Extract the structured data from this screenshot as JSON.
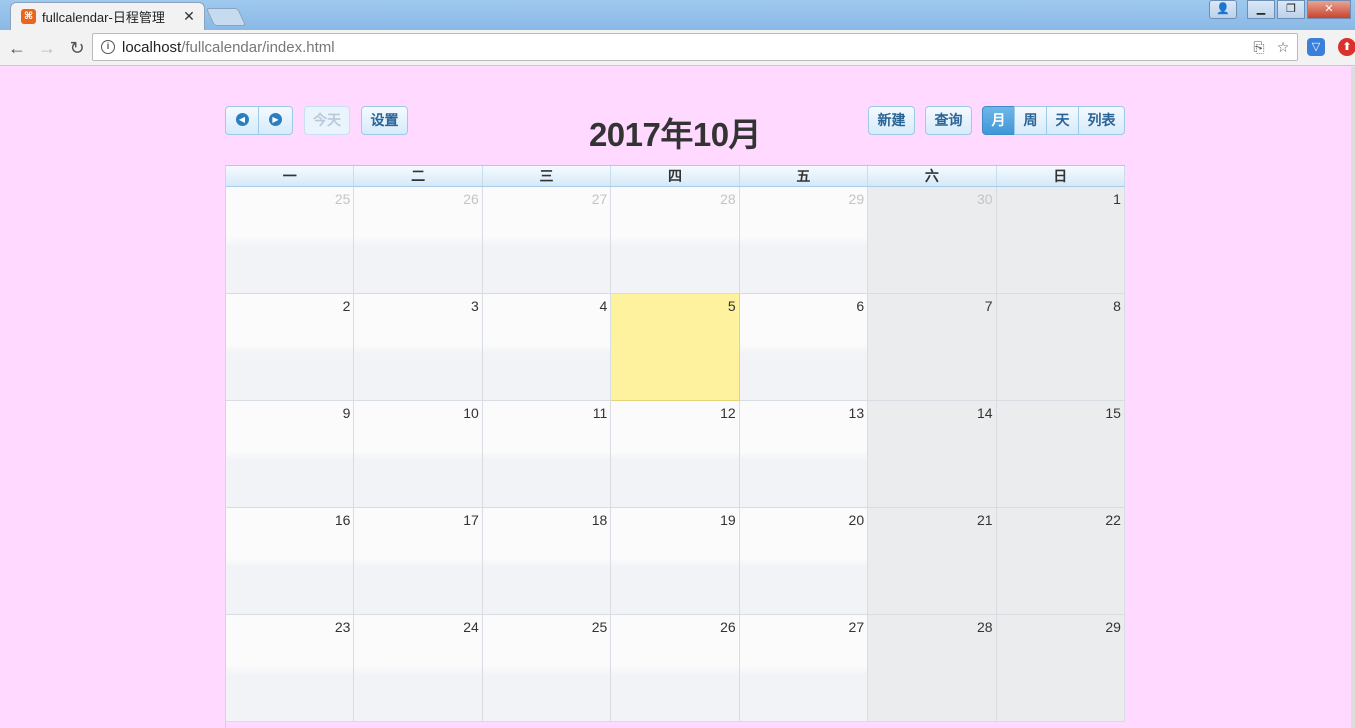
{
  "browser": {
    "tab_title": "fullcalendar-日程管理",
    "url_host": "localhost",
    "url_path": "/fullcalendar/index.html",
    "icons": [
      "back-icon",
      "forward-icon",
      "reload-icon",
      "info-icon",
      "translate-icon",
      "star-icon"
    ]
  },
  "calendar": {
    "title": "2017年10月",
    "buttons": {
      "today": "今天",
      "settings": "设置",
      "new": "新建",
      "query": "查询",
      "view_month": "月",
      "view_week": "周",
      "view_day": "天",
      "view_list": "列表"
    },
    "active_view": "月",
    "weekdays": [
      "一",
      "二",
      "三",
      "四",
      "五",
      "六",
      "日"
    ],
    "weeks": [
      [
        {
          "d": "25",
          "other": true
        },
        {
          "d": "26",
          "other": true
        },
        {
          "d": "27",
          "other": true
        },
        {
          "d": "28",
          "other": true
        },
        {
          "d": "29",
          "other": true
        },
        {
          "d": "30",
          "other": true
        },
        {
          "d": "1"
        }
      ],
      [
        {
          "d": "2"
        },
        {
          "d": "3"
        },
        {
          "d": "4"
        },
        {
          "d": "5",
          "today": true
        },
        {
          "d": "6"
        },
        {
          "d": "7"
        },
        {
          "d": "8"
        }
      ],
      [
        {
          "d": "9"
        },
        {
          "d": "10"
        },
        {
          "d": "11"
        },
        {
          "d": "12"
        },
        {
          "d": "13"
        },
        {
          "d": "14"
        },
        {
          "d": "15"
        }
      ],
      [
        {
          "d": "16"
        },
        {
          "d": "17"
        },
        {
          "d": "18"
        },
        {
          "d": "19"
        },
        {
          "d": "20"
        },
        {
          "d": "21"
        },
        {
          "d": "22"
        }
      ],
      [
        {
          "d": "23"
        },
        {
          "d": "24"
        },
        {
          "d": "25"
        },
        {
          "d": "26"
        },
        {
          "d": "27"
        },
        {
          "d": "28"
        },
        {
          "d": "29"
        }
      ]
    ]
  },
  "colors": {
    "page_background": "#ffd9ff",
    "today_highlight": "#fff29e",
    "active_button": "#3d98d6"
  }
}
